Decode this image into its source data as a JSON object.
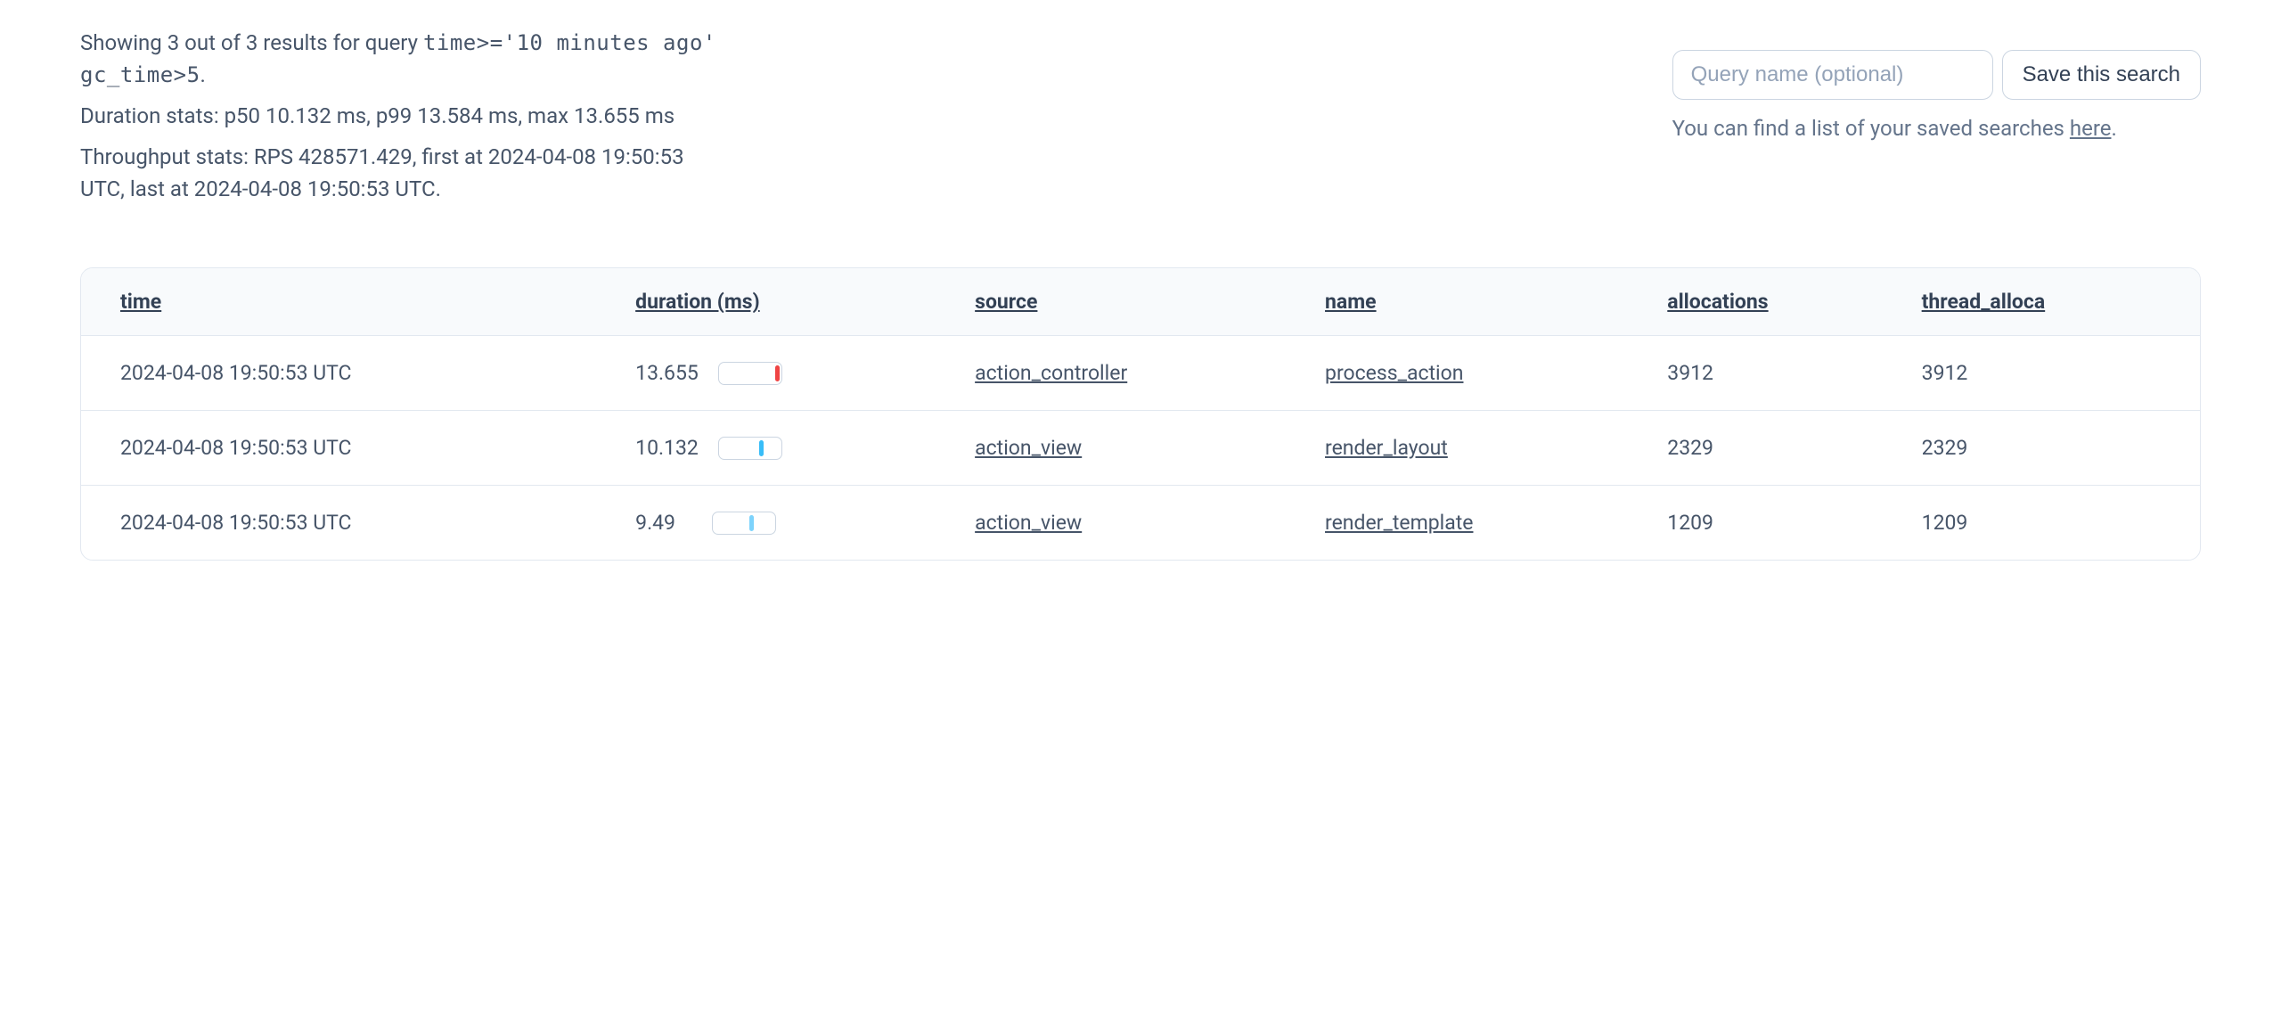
{
  "summary": {
    "results_prefix": "Showing 3 out of 3 results for query ",
    "query": "time>='10 minutes ago' gc_time>5",
    "results_suffix": ".",
    "duration_stats": "Duration stats: p50 10.132 ms, p99 13.584 ms, max 13.655 ms",
    "throughput_stats": "Throughput stats: RPS 428571.429, first at 2024-04-08 19:50:53 UTC, last at 2024-04-08 19:50:53 UTC."
  },
  "save_panel": {
    "placeholder": "Query name (optional)",
    "button": "Save this search",
    "hint_prefix": "You can find a list of your saved searches ",
    "hint_link": "here",
    "hint_suffix": "."
  },
  "table": {
    "headers": {
      "time": "time",
      "duration": "duration (ms)",
      "source": "source",
      "name": "name",
      "allocations": "allocations",
      "thread_allocations": "thread_alloca"
    },
    "rows": [
      {
        "time": "2024-04-08 19:50:53 UTC",
        "duration": "13.655",
        "marker_position_pct": 90,
        "marker_color": "#ef4444",
        "source": "action_controller",
        "name": "process_action",
        "allocations": "3912",
        "thread_allocations": "3912"
      },
      {
        "time": "2024-04-08 19:50:53 UTC",
        "duration": "10.132",
        "marker_position_pct": 65,
        "marker_color": "#38bdf8",
        "source": "action_view",
        "name": "render_layout",
        "allocations": "2329",
        "thread_allocations": "2329"
      },
      {
        "time": "2024-04-08 19:50:53 UTC",
        "duration": "9.49",
        "marker_position_pct": 58,
        "marker_color": "#7dd3fc",
        "source": "action_view",
        "name": "render_template",
        "allocations": "1209",
        "thread_allocations": "1209"
      }
    ]
  }
}
